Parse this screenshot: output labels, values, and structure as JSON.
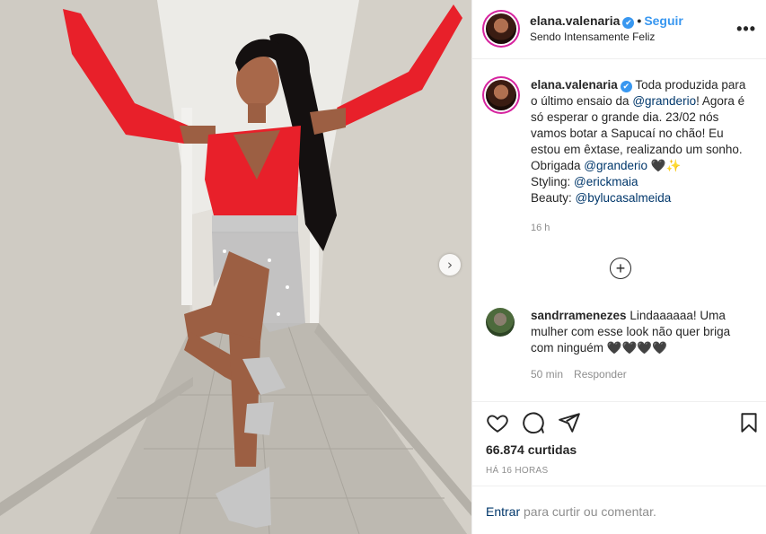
{
  "post": {
    "username": "elana.valenaria",
    "verified_mark": "✔",
    "separator": "•",
    "follow_label": "Seguir",
    "location": "Sendo Intensamente Feliz",
    "more_label": "•••",
    "next_label": "›"
  },
  "caption": {
    "username": "elana.valenaria",
    "parts": [
      "Toda produzida para o último ensaio da ",
      "@granderio",
      "! Agora é só esperar o grande dia. 23/02 nós vamos botar a Sapucaí no chão! Eu estou em êxtase, realizando um sonho. Obrigada ",
      "@granderio",
      " 🖤✨",
      "Styling: ",
      "@erickmaia",
      "Beauty: ",
      "@bylucasalmeida"
    ],
    "time": "16 h"
  },
  "load_more_label": "+",
  "comment": {
    "username": "sandrramenezes",
    "text": "Lindaaaaaa! Uma mulher com esse look não quer briga com ninguém 🖤🖤🖤🖤",
    "time": "50 min",
    "reply_label": "Responder"
  },
  "actions": {
    "icons": [
      "heart-icon",
      "comment-icon",
      "share-icon",
      "bookmark-icon"
    ],
    "likes": "66.874 curtidas",
    "posted": "HÁ 16 HORAS"
  },
  "login": {
    "link": "Entrar",
    "rest": "para curtir ou comentar."
  },
  "colors": {
    "accent": "#3897f0",
    "mention": "#00376b",
    "muted": "#8e8e8e",
    "dress": "#e8202a"
  }
}
